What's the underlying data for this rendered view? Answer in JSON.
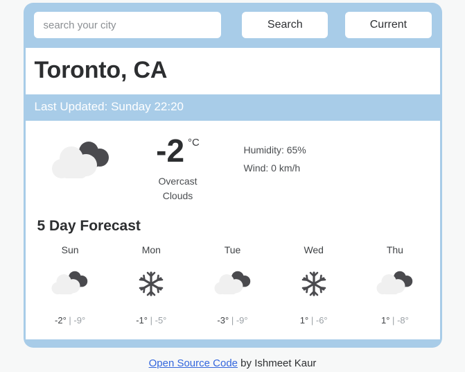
{
  "search": {
    "placeholder": "search your city",
    "value": "",
    "search_button": "Search",
    "current_button": "Current"
  },
  "location": {
    "city": "Toronto, CA",
    "last_updated": "Last Updated: Sunday 22:20"
  },
  "current": {
    "icon": "overcast-clouds-icon",
    "temperature": "-2",
    "unit": "°C",
    "description": "Overcast Clouds",
    "humidity": "Humidity: 65%",
    "wind": "Wind: 0 km/h"
  },
  "forecast": {
    "title": "5 Day Forecast",
    "days": [
      {
        "name": "Sun",
        "icon": "overcast-clouds-icon",
        "high": "-2°",
        "sep": "|",
        "low": "-9°"
      },
      {
        "name": "Mon",
        "icon": "snowflake-icon",
        "high": "-1°",
        "sep": "|",
        "low": "-5°"
      },
      {
        "name": "Tue",
        "icon": "overcast-clouds-icon",
        "high": "-3°",
        "sep": "|",
        "low": "-9°"
      },
      {
        "name": "Wed",
        "icon": "snowflake-icon",
        "high": "1°",
        "sep": "|",
        "low": "-6°"
      },
      {
        "name": "Thu",
        "icon": "overcast-clouds-icon",
        "high": "1°",
        "sep": "|",
        "low": "-8°"
      }
    ]
  },
  "footer": {
    "link_text": "Open Source Code",
    "credit": " by Ishmeet Kaur"
  },
  "colors": {
    "card_blue": "#a8cce8",
    "page_background": "#f7f8f8",
    "cloud_dark": "#4a4a4e",
    "cloud_light": "#f0f0f0",
    "link_blue": "#3366dd"
  }
}
